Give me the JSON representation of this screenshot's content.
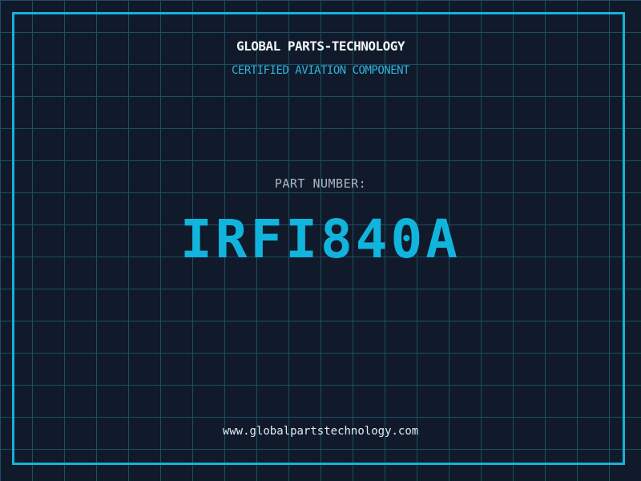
{
  "header": {
    "company": "GLOBAL PARTS-TECHNOLOGY",
    "tagline": "CERTIFIED AVIATION COMPONENT"
  },
  "part": {
    "label": "PART NUMBER:",
    "number": "IRFI840A"
  },
  "footer": {
    "website": "www.globalpartstechnology.com"
  },
  "colors": {
    "background": "#101a2b",
    "grid_line": "#1d4f63",
    "frame": "#14b2da",
    "accent_cyan": "#11b4dc",
    "tagline_cyan": "#2eb3da",
    "title_white": "#f2f5f7",
    "label_gray": "#aeb8c2",
    "website_white": "#e4eaef"
  }
}
